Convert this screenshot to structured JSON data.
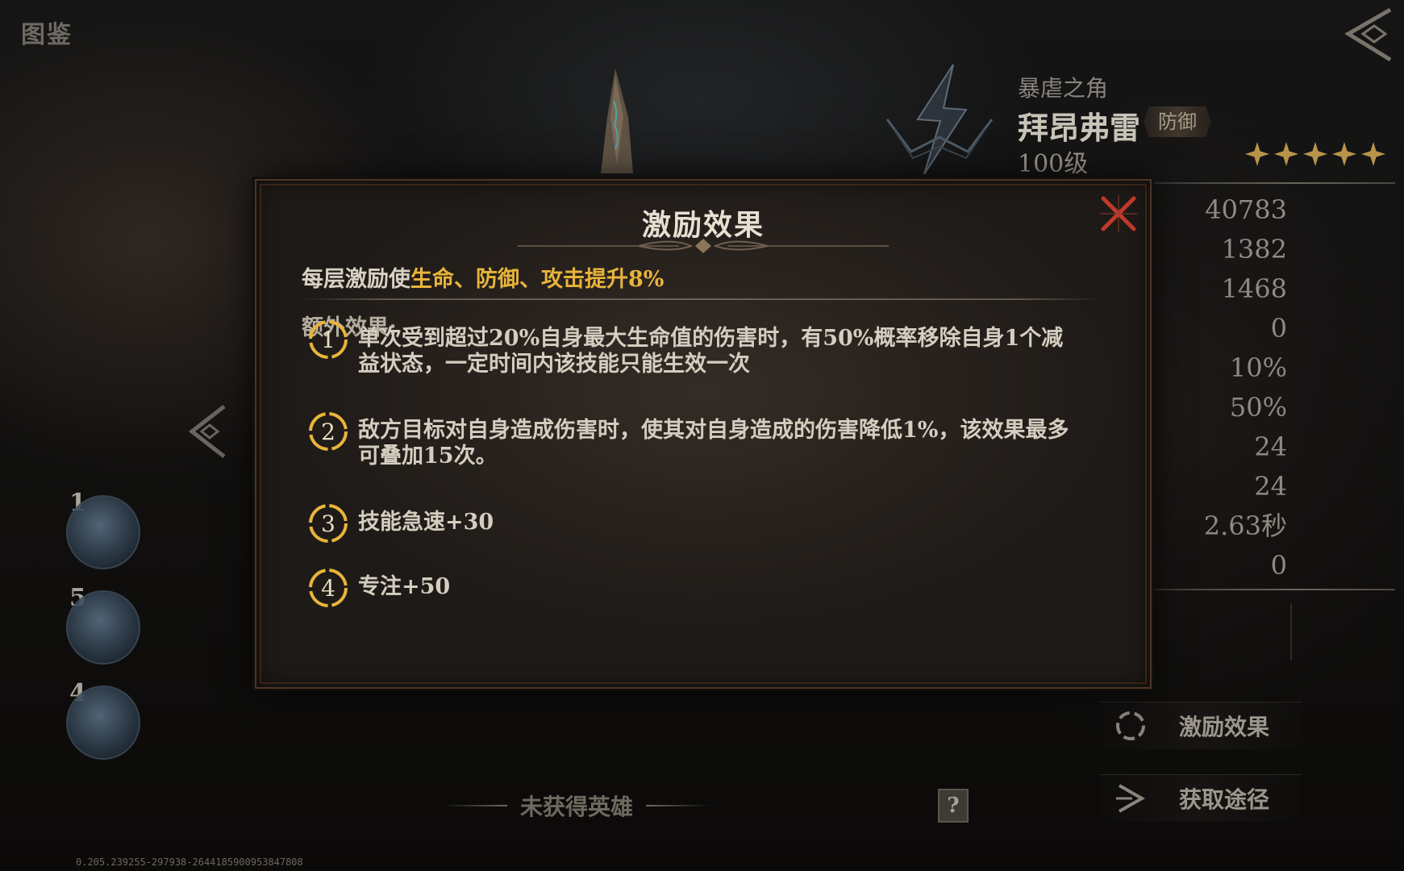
{
  "header": {
    "title": "图鉴"
  },
  "hero": {
    "subtitle": "暴虐之角",
    "name": "拜昂弗雷",
    "role": "防御",
    "level": "100级",
    "star_count": 5,
    "star_color": "#b8934a"
  },
  "stats": [
    "40783",
    "1382",
    "1468",
    "0",
    "10%",
    "50%",
    "24",
    "24",
    "2.63秒",
    "0"
  ],
  "side_buttons": {
    "incentive_label": "激励效果",
    "obtain_label": "获取途径"
  },
  "left_panel": {
    "slots": [
      {
        "number": "1"
      },
      {
        "number": "5"
      },
      {
        "number": "4"
      }
    ]
  },
  "footer": {
    "status": "未获得英雄",
    "help": "?",
    "build_id": "0.205.239255-297938-2644185900953847808"
  },
  "modal": {
    "title": "激励效果",
    "headline_prefix": "每层激励使",
    "headline_highlight": "生命、防御、攻击提升8%",
    "extra_label": "额外效果:",
    "effects": [
      {
        "number": "1",
        "text": "单次受到超过20%自身最大生命值的伤害时，有50%概率移除自身1个减益状态，一定时间内该技能只能生效一次"
      },
      {
        "number": "2",
        "text": "敌方目标对自身造成伤害时，使其对自身造成的伤害降低1%，该效果最多可叠加15次。"
      },
      {
        "number": "3",
        "text": "技能急速+30"
      },
      {
        "number": "4",
        "text": "专注+50"
      }
    ],
    "accent_color": "#e8b43a",
    "close_color": "#c0392b"
  }
}
